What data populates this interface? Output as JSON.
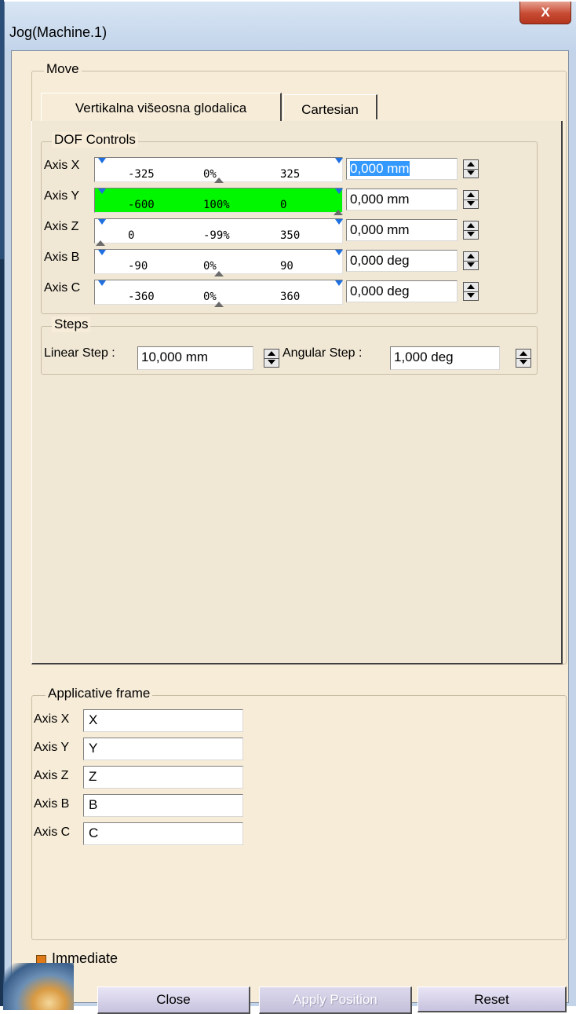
{
  "window": {
    "title": "Jog(Machine.1)",
    "close_glyph": "X"
  },
  "move": {
    "legend": "Move",
    "tabs": [
      {
        "label": "Vertikalna višeosna glodalica",
        "active": true
      },
      {
        "label": "Cartesian",
        "active": false
      }
    ],
    "dof": {
      "legend": "DOF Controls",
      "axes": [
        {
          "label": "Axis X",
          "min": "-325",
          "pct": "0%",
          "max": "325",
          "value_sel": "0,000 mm",
          "value": "",
          "highlight": false
        },
        {
          "label": "Axis Y",
          "min": "-600",
          "pct": "100%",
          "max": "0",
          "value_sel": "",
          "value": "0,000 mm",
          "highlight": true,
          "highlight_color": "#00f700"
        },
        {
          "label": "Axis Z",
          "min": "0",
          "pct": "-99%",
          "max": "350",
          "value_sel": "",
          "value": "0,000 mm",
          "highlight": false
        },
        {
          "label": "Axis B",
          "min": "-90",
          "pct": "0%",
          "max": "90",
          "value_sel": "",
          "value": "0,000 deg",
          "highlight": false
        },
        {
          "label": "Axis C",
          "min": "-360",
          "pct": "0%",
          "max": "360",
          "value_sel": "",
          "value": "0,000 deg",
          "highlight": false
        }
      ]
    },
    "steps": {
      "legend": "Steps",
      "linear_label": "Linear Step :",
      "linear_value": "10,000 mm",
      "angular_label": "Angular Step :",
      "angular_value": "1,000 deg"
    }
  },
  "applicative_frame": {
    "legend": "Applicative frame",
    "axes": [
      {
        "label": "Axis X",
        "value": "X"
      },
      {
        "label": "Axis Y",
        "value": "Y"
      },
      {
        "label": "Axis Z",
        "value": "Z"
      },
      {
        "label": "Axis B",
        "value": "B"
      },
      {
        "label": "Axis C",
        "value": "C"
      }
    ]
  },
  "immediate": {
    "label": "Immediate",
    "checked": true,
    "color": "#e07a18"
  },
  "buttons": {
    "close": "Close",
    "apply": "Apply Position",
    "reset": "Reset"
  }
}
